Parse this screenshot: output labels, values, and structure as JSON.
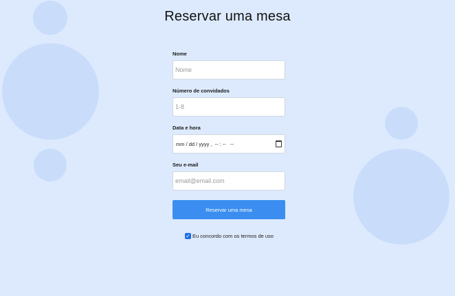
{
  "page": {
    "title": "Reservar uma mesa"
  },
  "form": {
    "name": {
      "label": "Nome",
      "placeholder": "Nome",
      "value": ""
    },
    "guests": {
      "label": "Número de convidados",
      "placeholder": "1-8",
      "value": ""
    },
    "datetime": {
      "label": "Data e hora",
      "placeholder": "mm / dd / yyyy ,  -- : --   --",
      "icon": "calendar-icon"
    },
    "email": {
      "label": "Seu e-mail",
      "placeholder": "email@email.com",
      "value": ""
    },
    "submit_label": "Reservar uma mesa",
    "terms": {
      "label": "Eu concordo com os termos de uso",
      "checked": true
    }
  },
  "colors": {
    "background": "#ddeafd",
    "circle": "#c9ddfb",
    "accent": "#3b8ef0",
    "checkbox": "#1f6fe0"
  }
}
